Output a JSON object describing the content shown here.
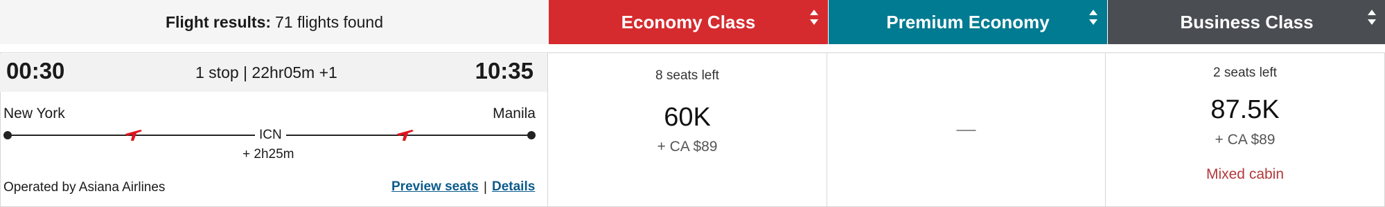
{
  "results": {
    "label": "Flight results:",
    "count_text": "71 flights found"
  },
  "tabs": [
    {
      "label": "Economy Class",
      "color": "#d52b2f"
    },
    {
      "label": "Premium Economy",
      "color": "#007b91"
    },
    {
      "label": "Business Class",
      "color": "#4a4d52"
    }
  ],
  "flight": {
    "departure_time": "00:30",
    "arrival_time": "10:35",
    "stop_summary": "1 stop | 22hr05m +1",
    "origin_city": "New York",
    "destination_city": "Manila",
    "layover_airport": "ICN",
    "layover_duration": "+ 2h25m",
    "operated_by": "Operated by Asiana Airlines",
    "preview_seats_label": "Preview seats",
    "separator": "|",
    "details_label": "Details"
  },
  "fares": {
    "economy": {
      "seats_left": "8 seats left",
      "price": "60K",
      "tax": "+ CA $89"
    },
    "premium_economy": {
      "unavailable": "—"
    },
    "business": {
      "seats_left": "2 seats left",
      "price": "87.5K",
      "tax": "+ CA $89",
      "note": "Mixed cabin"
    }
  },
  "icons": {
    "plane": "airline-tail-logo-icon",
    "sort": "sort-icon",
    "route_dot": "route-dot-icon"
  }
}
